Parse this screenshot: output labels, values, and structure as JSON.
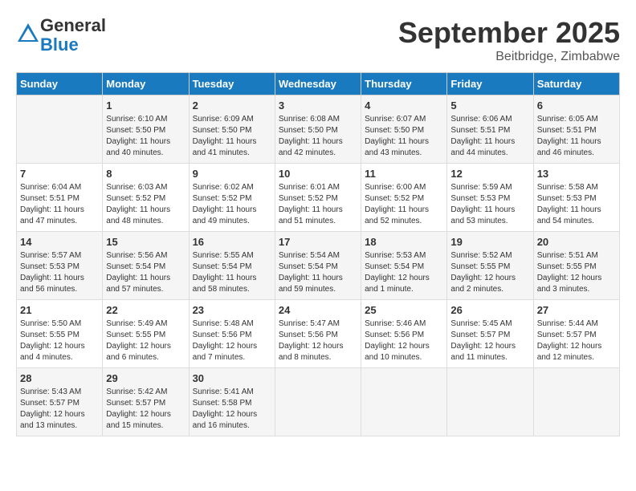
{
  "logo": {
    "general": "General",
    "blue": "Blue"
  },
  "title": "September 2025",
  "location": "Beitbridge, Zimbabwe",
  "days_of_week": [
    "Sunday",
    "Monday",
    "Tuesday",
    "Wednesday",
    "Thursday",
    "Friday",
    "Saturday"
  ],
  "weeks": [
    [
      {
        "day": "",
        "info": ""
      },
      {
        "day": "1",
        "info": "Sunrise: 6:10 AM\nSunset: 5:50 PM\nDaylight: 11 hours\nand 40 minutes."
      },
      {
        "day": "2",
        "info": "Sunrise: 6:09 AM\nSunset: 5:50 PM\nDaylight: 11 hours\nand 41 minutes."
      },
      {
        "day": "3",
        "info": "Sunrise: 6:08 AM\nSunset: 5:50 PM\nDaylight: 11 hours\nand 42 minutes."
      },
      {
        "day": "4",
        "info": "Sunrise: 6:07 AM\nSunset: 5:50 PM\nDaylight: 11 hours\nand 43 minutes."
      },
      {
        "day": "5",
        "info": "Sunrise: 6:06 AM\nSunset: 5:51 PM\nDaylight: 11 hours\nand 44 minutes."
      },
      {
        "day": "6",
        "info": "Sunrise: 6:05 AM\nSunset: 5:51 PM\nDaylight: 11 hours\nand 46 minutes."
      }
    ],
    [
      {
        "day": "7",
        "info": "Sunrise: 6:04 AM\nSunset: 5:51 PM\nDaylight: 11 hours\nand 47 minutes."
      },
      {
        "day": "8",
        "info": "Sunrise: 6:03 AM\nSunset: 5:52 PM\nDaylight: 11 hours\nand 48 minutes."
      },
      {
        "day": "9",
        "info": "Sunrise: 6:02 AM\nSunset: 5:52 PM\nDaylight: 11 hours\nand 49 minutes."
      },
      {
        "day": "10",
        "info": "Sunrise: 6:01 AM\nSunset: 5:52 PM\nDaylight: 11 hours\nand 51 minutes."
      },
      {
        "day": "11",
        "info": "Sunrise: 6:00 AM\nSunset: 5:52 PM\nDaylight: 11 hours\nand 52 minutes."
      },
      {
        "day": "12",
        "info": "Sunrise: 5:59 AM\nSunset: 5:53 PM\nDaylight: 11 hours\nand 53 minutes."
      },
      {
        "day": "13",
        "info": "Sunrise: 5:58 AM\nSunset: 5:53 PM\nDaylight: 11 hours\nand 54 minutes."
      }
    ],
    [
      {
        "day": "14",
        "info": "Sunrise: 5:57 AM\nSunset: 5:53 PM\nDaylight: 11 hours\nand 56 minutes."
      },
      {
        "day": "15",
        "info": "Sunrise: 5:56 AM\nSunset: 5:54 PM\nDaylight: 11 hours\nand 57 minutes."
      },
      {
        "day": "16",
        "info": "Sunrise: 5:55 AM\nSunset: 5:54 PM\nDaylight: 11 hours\nand 58 minutes."
      },
      {
        "day": "17",
        "info": "Sunrise: 5:54 AM\nSunset: 5:54 PM\nDaylight: 11 hours\nand 59 minutes."
      },
      {
        "day": "18",
        "info": "Sunrise: 5:53 AM\nSunset: 5:54 PM\nDaylight: 12 hours\nand 1 minute."
      },
      {
        "day": "19",
        "info": "Sunrise: 5:52 AM\nSunset: 5:55 PM\nDaylight: 12 hours\nand 2 minutes."
      },
      {
        "day": "20",
        "info": "Sunrise: 5:51 AM\nSunset: 5:55 PM\nDaylight: 12 hours\nand 3 minutes."
      }
    ],
    [
      {
        "day": "21",
        "info": "Sunrise: 5:50 AM\nSunset: 5:55 PM\nDaylight: 12 hours\nand 4 minutes."
      },
      {
        "day": "22",
        "info": "Sunrise: 5:49 AM\nSunset: 5:55 PM\nDaylight: 12 hours\nand 6 minutes."
      },
      {
        "day": "23",
        "info": "Sunrise: 5:48 AM\nSunset: 5:56 PM\nDaylight: 12 hours\nand 7 minutes."
      },
      {
        "day": "24",
        "info": "Sunrise: 5:47 AM\nSunset: 5:56 PM\nDaylight: 12 hours\nand 8 minutes."
      },
      {
        "day": "25",
        "info": "Sunrise: 5:46 AM\nSunset: 5:56 PM\nDaylight: 12 hours\nand 10 minutes."
      },
      {
        "day": "26",
        "info": "Sunrise: 5:45 AM\nSunset: 5:57 PM\nDaylight: 12 hours\nand 11 minutes."
      },
      {
        "day": "27",
        "info": "Sunrise: 5:44 AM\nSunset: 5:57 PM\nDaylight: 12 hours\nand 12 minutes."
      }
    ],
    [
      {
        "day": "28",
        "info": "Sunrise: 5:43 AM\nSunset: 5:57 PM\nDaylight: 12 hours\nand 13 minutes."
      },
      {
        "day": "29",
        "info": "Sunrise: 5:42 AM\nSunset: 5:57 PM\nDaylight: 12 hours\nand 15 minutes."
      },
      {
        "day": "30",
        "info": "Sunrise: 5:41 AM\nSunset: 5:58 PM\nDaylight: 12 hours\nand 16 minutes."
      },
      {
        "day": "",
        "info": ""
      },
      {
        "day": "",
        "info": ""
      },
      {
        "day": "",
        "info": ""
      },
      {
        "day": "",
        "info": ""
      }
    ]
  ]
}
